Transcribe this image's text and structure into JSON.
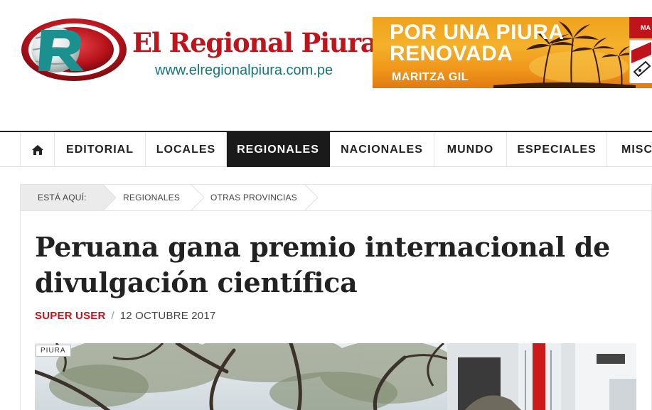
{
  "site": {
    "name": "El Regional Piura",
    "url": "www.elregionalpiura.com.pe",
    "logo_icon": "r-globe-logo",
    "brand_color": "#c0141c",
    "url_color": "#17767a"
  },
  "ad": {
    "line1": "POR UNA PIURA",
    "line2": "RENOVADA",
    "name": "MARITZA GIL",
    "badge_text": "MA",
    "colors": {
      "background": "#f0a11e",
      "text": "#ffffff"
    }
  },
  "nav": {
    "home_icon": "home-icon",
    "items": [
      {
        "label": "EDITORIAL"
      },
      {
        "label": "LOCALES"
      },
      {
        "label": "REGIONALES",
        "active": true
      },
      {
        "label": "NACIONALES"
      },
      {
        "label": "MUNDO"
      },
      {
        "label": "ESPECIALES"
      },
      {
        "label": "MISC"
      }
    ],
    "active_color": "#1a1a1a"
  },
  "breadcrumb": {
    "here_label": "ESTÁ AQUÍ:",
    "items": [
      {
        "label": "REGIONALES"
      },
      {
        "label": "OTRAS PROVINCIAS"
      }
    ]
  },
  "article": {
    "title": "Peruana gana premio internacional de divulgación científica",
    "author": "SUPER USER",
    "separator": "/",
    "date": "12 OCTUBRE 2017",
    "category_tag": "PIURA",
    "author_color": "#c0141c"
  }
}
